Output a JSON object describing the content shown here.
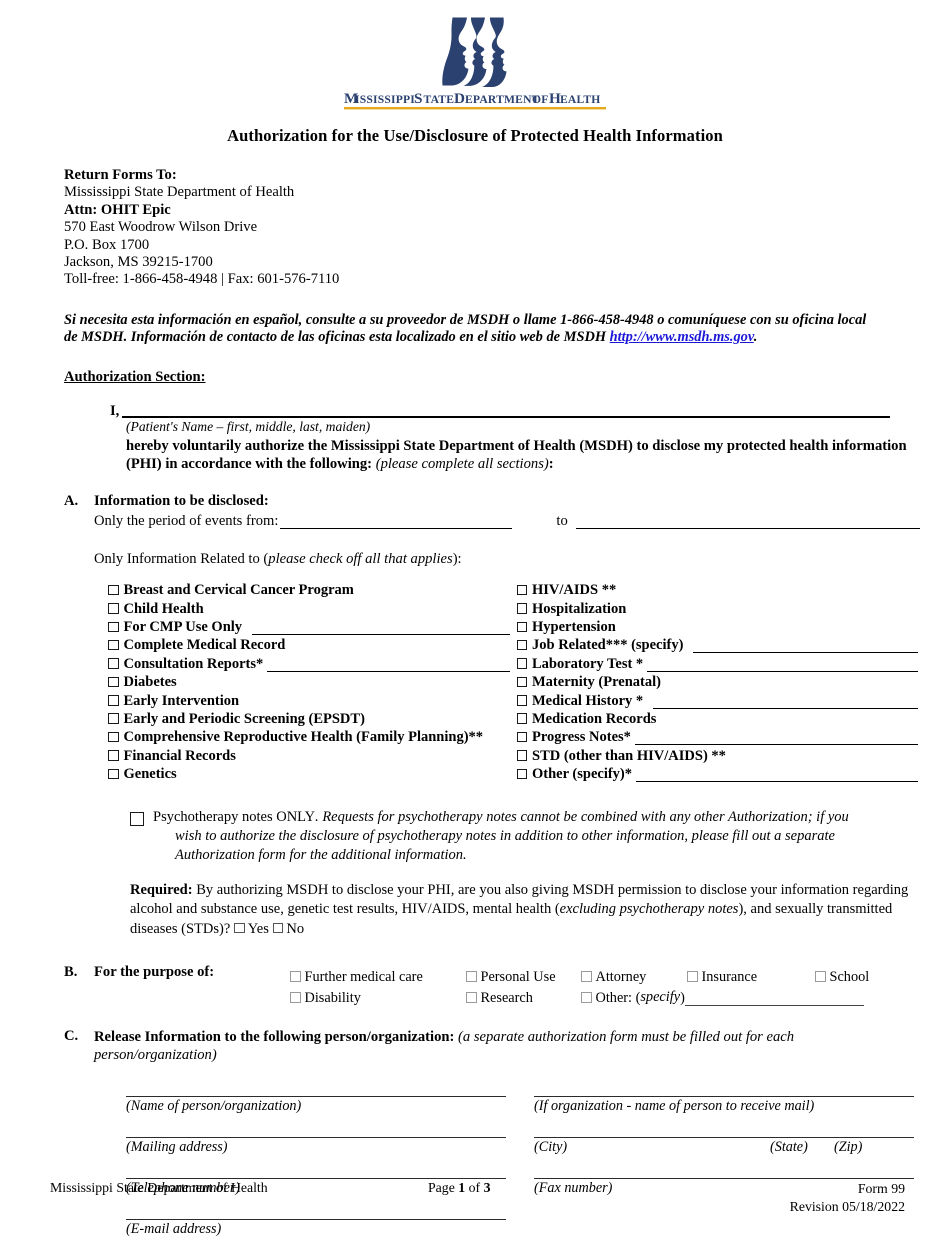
{
  "header": {
    "logo_name": "msdh-logo",
    "wordmark": "Mississippi State Department of Health",
    "logo_navy": "#2b4170",
    "logo_gold": "#e8a817",
    "title": "Authorization for the Use/Disclosure of Protected Health Information"
  },
  "return_forms": {
    "heading": "Return Forms To:",
    "org": "Mississippi State Department of Health",
    "attn": "Attn: OHIT Epic",
    "street": "570 East Woodrow Wilson Drive",
    "po_box": "P.O. Box 1700",
    "city_state_zip": "Jackson, MS 39215-1700",
    "phone_fax": "Toll-free: 1-866-458-4948 | Fax: 601-576-7110"
  },
  "spanish_notice": {
    "line1": "Si necesita esta información en español, consulte a su proveedor de MSDH o llame 1-866-458-4948 o comuníquese con su",
    "line2": "oficina local de MSDH. Información de contacto de las oficinas esta localizado en el sitio web de MSDH",
    "link": "http://www.msdh.ms.gov",
    "period": "."
  },
  "authorization": {
    "section_heading": "Authorization Section:",
    "i_label": "I,",
    "name_caption": "(Patient's Name – first, middle, last, maiden)",
    "para_bold_1": "hereby voluntarily authorize the Mississippi State Department of Health (MSDH) to disclose my protected health",
    "para_bold_2": "information (PHI) in accordance with the following:",
    "para_italic": "(please complete all sections)",
    "para_end": ":"
  },
  "section_a": {
    "letter": "A.",
    "heading": "Information to be disclosed:",
    "period_label": "Only the period of events from:",
    "to_label": "to",
    "related_prefix": "Only Information Related to (",
    "related_italic": "please check off all that applies",
    "related_suffix": "):",
    "left_items": [
      {
        "label": "Breast and Cervical Cancer Program",
        "line": false
      },
      {
        "label": "Child Health",
        "line": false
      },
      {
        "label": "For CMP Use Only",
        "line": true
      },
      {
        "label": "Complete Medical Record",
        "line": false
      },
      {
        "label": "Consultation Reports*",
        "line": true
      },
      {
        "label": "Diabetes",
        "line": false
      },
      {
        "label": "Early Intervention",
        "line": false
      },
      {
        "label": "Early and Periodic Screening (EPSDT)",
        "line": false
      },
      {
        "label": "Comprehensive Reproductive Health (Family Planning)**",
        "line": false
      },
      {
        "label": "Financial Records",
        "line": false
      },
      {
        "label": "Genetics",
        "line": false
      }
    ],
    "right_items": [
      {
        "label": "HIV/AIDS **",
        "line": false
      },
      {
        "label": "Hospitalization",
        "line": false
      },
      {
        "label": "Hypertension",
        "line": false
      },
      {
        "label": "Job Related*** (specify)",
        "line": true
      },
      {
        "label": "Laboratory Test *",
        "line": true
      },
      {
        "label": "Maternity (Prenatal)",
        "line": false
      },
      {
        "label": "Medical History *",
        "line": true
      },
      {
        "label": "Medication Records",
        "line": false
      },
      {
        "label": "Progress Notes*",
        "line": true
      },
      {
        "label": "STD (other than HIV/AIDS) **",
        "line": false
      },
      {
        "label": "Other (specify)*",
        "line": true
      }
    ],
    "psychotherapy": {
      "lead": "Psychotherapy notes ONLY",
      "italic_1": ". Requests for psychotherapy notes cannot be combined with any other Authorization; if you",
      "italic_2": "wish to authorize the disclosure of psychotherapy notes in addition to other information, please fill out a separate",
      "italic_3": "Authorization form for the additional information."
    },
    "required": {
      "bold_label": "Required:",
      "text_1": " By authorizing MSDH to disclose your PHI, are you also giving MSDH permission to disclose your information regarding alcohol and substance use, genetic test results, HIV/AIDS, mental health (",
      "italic_part": "excluding psychotherapy notes",
      "text_2": "), and sexually transmitted diseases (STDs)?",
      "yes_label": "Yes",
      "no_label": "No"
    }
  },
  "section_b": {
    "letter": "B.",
    "heading": "For the purpose of:",
    "row1": [
      "Further medical care",
      "Personal Use",
      "Attorney",
      "Insurance",
      "School"
    ],
    "row2": [
      "Disability",
      "Research"
    ],
    "other_label": "Other: (",
    "other_italic": "specify",
    "other_suffix": ")"
  },
  "section_c": {
    "letter": "C.",
    "heading_bold": "Release Information to the following person/organization:",
    "heading_italic_1": " (a separate authorization form must be filled out for",
    "heading_italic_2": "each person/organization)",
    "fields": {
      "name_of_org": "(Name of person/organization)",
      "receive_mail": "(If organization - name of person to receive mail)",
      "mailing_address": "(Mailing address)",
      "city": "(City)",
      "state": "(State)",
      "zip": "(Zip)",
      "telephone": "(Telephone number)",
      "fax": "(Fax number)",
      "email": "(E-mail address)"
    }
  },
  "footer": {
    "left": "Mississippi State Department of Health",
    "page_prefix": "Page ",
    "page_number": "1",
    "page_middle": " of ",
    "page_total": "3",
    "form": "Form 99",
    "revision": "Revision 05/18/2022"
  }
}
